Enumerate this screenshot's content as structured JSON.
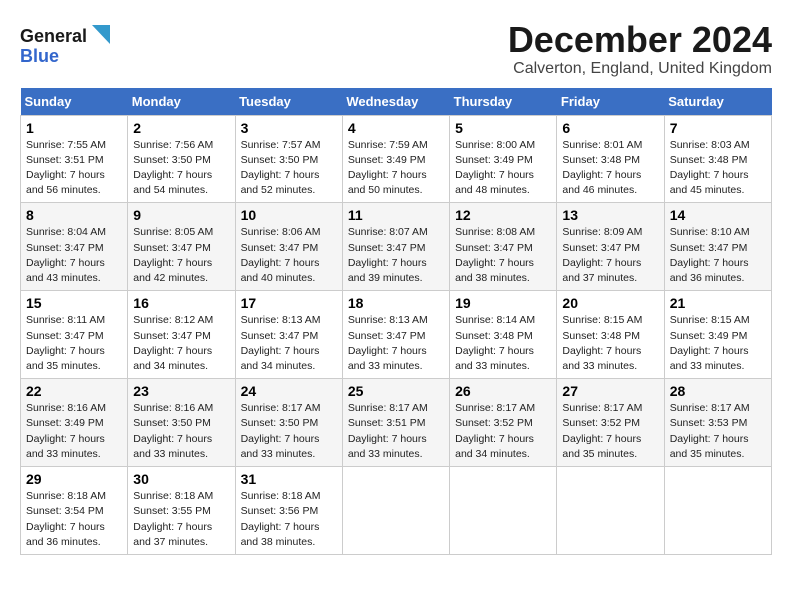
{
  "header": {
    "logo_line1": "General",
    "logo_line2": "Blue",
    "month_title": "December 2024",
    "location": "Calverton, England, United Kingdom"
  },
  "days_of_week": [
    "Sunday",
    "Monday",
    "Tuesday",
    "Wednesday",
    "Thursday",
    "Friday",
    "Saturday"
  ],
  "weeks": [
    [
      {
        "day": "1",
        "sunrise": "7:55 AM",
        "sunset": "3:51 PM",
        "daylight_hours": "7 hours and 56 minutes"
      },
      {
        "day": "2",
        "sunrise": "7:56 AM",
        "sunset": "3:50 PM",
        "daylight_hours": "7 hours and 54 minutes"
      },
      {
        "day": "3",
        "sunrise": "7:57 AM",
        "sunset": "3:50 PM",
        "daylight_hours": "7 hours and 52 minutes"
      },
      {
        "day": "4",
        "sunrise": "7:59 AM",
        "sunset": "3:49 PM",
        "daylight_hours": "7 hours and 50 minutes"
      },
      {
        "day": "5",
        "sunrise": "8:00 AM",
        "sunset": "3:49 PM",
        "daylight_hours": "7 hours and 48 minutes"
      },
      {
        "day": "6",
        "sunrise": "8:01 AM",
        "sunset": "3:48 PM",
        "daylight_hours": "7 hours and 46 minutes"
      },
      {
        "day": "7",
        "sunrise": "8:03 AM",
        "sunset": "3:48 PM",
        "daylight_hours": "7 hours and 45 minutes"
      }
    ],
    [
      {
        "day": "8",
        "sunrise": "8:04 AM",
        "sunset": "3:47 PM",
        "daylight_hours": "7 hours and 43 minutes"
      },
      {
        "day": "9",
        "sunrise": "8:05 AM",
        "sunset": "3:47 PM",
        "daylight_hours": "7 hours and 42 minutes"
      },
      {
        "day": "10",
        "sunrise": "8:06 AM",
        "sunset": "3:47 PM",
        "daylight_hours": "7 hours and 40 minutes"
      },
      {
        "day": "11",
        "sunrise": "8:07 AM",
        "sunset": "3:47 PM",
        "daylight_hours": "7 hours and 39 minutes"
      },
      {
        "day": "12",
        "sunrise": "8:08 AM",
        "sunset": "3:47 PM",
        "daylight_hours": "7 hours and 38 minutes"
      },
      {
        "day": "13",
        "sunrise": "8:09 AM",
        "sunset": "3:47 PM",
        "daylight_hours": "7 hours and 37 minutes"
      },
      {
        "day": "14",
        "sunrise": "8:10 AM",
        "sunset": "3:47 PM",
        "daylight_hours": "7 hours and 36 minutes"
      }
    ],
    [
      {
        "day": "15",
        "sunrise": "8:11 AM",
        "sunset": "3:47 PM",
        "daylight_hours": "7 hours and 35 minutes"
      },
      {
        "day": "16",
        "sunrise": "8:12 AM",
        "sunset": "3:47 PM",
        "daylight_hours": "7 hours and 34 minutes"
      },
      {
        "day": "17",
        "sunrise": "8:13 AM",
        "sunset": "3:47 PM",
        "daylight_hours": "7 hours and 34 minutes"
      },
      {
        "day": "18",
        "sunrise": "8:13 AM",
        "sunset": "3:47 PM",
        "daylight_hours": "7 hours and 33 minutes"
      },
      {
        "day": "19",
        "sunrise": "8:14 AM",
        "sunset": "3:48 PM",
        "daylight_hours": "7 hours and 33 minutes"
      },
      {
        "day": "20",
        "sunrise": "8:15 AM",
        "sunset": "3:48 PM",
        "daylight_hours": "7 hours and 33 minutes"
      },
      {
        "day": "21",
        "sunrise": "8:15 AM",
        "sunset": "3:49 PM",
        "daylight_hours": "7 hours and 33 minutes"
      }
    ],
    [
      {
        "day": "22",
        "sunrise": "8:16 AM",
        "sunset": "3:49 PM",
        "daylight_hours": "7 hours and 33 minutes"
      },
      {
        "day": "23",
        "sunrise": "8:16 AM",
        "sunset": "3:50 PM",
        "daylight_hours": "7 hours and 33 minutes"
      },
      {
        "day": "24",
        "sunrise": "8:17 AM",
        "sunset": "3:50 PM",
        "daylight_hours": "7 hours and 33 minutes"
      },
      {
        "day": "25",
        "sunrise": "8:17 AM",
        "sunset": "3:51 PM",
        "daylight_hours": "7 hours and 33 minutes"
      },
      {
        "day": "26",
        "sunrise": "8:17 AM",
        "sunset": "3:52 PM",
        "daylight_hours": "7 hours and 34 minutes"
      },
      {
        "day": "27",
        "sunrise": "8:17 AM",
        "sunset": "3:52 PM",
        "daylight_hours": "7 hours and 35 minutes"
      },
      {
        "day": "28",
        "sunrise": "8:17 AM",
        "sunset": "3:53 PM",
        "daylight_hours": "7 hours and 35 minutes"
      }
    ],
    [
      {
        "day": "29",
        "sunrise": "8:18 AM",
        "sunset": "3:54 PM",
        "daylight_hours": "7 hours and 36 minutes"
      },
      {
        "day": "30",
        "sunrise": "8:18 AM",
        "sunset": "3:55 PM",
        "daylight_hours": "7 hours and 37 minutes"
      },
      {
        "day": "31",
        "sunrise": "8:18 AM",
        "sunset": "3:56 PM",
        "daylight_hours": "7 hours and 38 minutes"
      },
      null,
      null,
      null,
      null
    ]
  ]
}
